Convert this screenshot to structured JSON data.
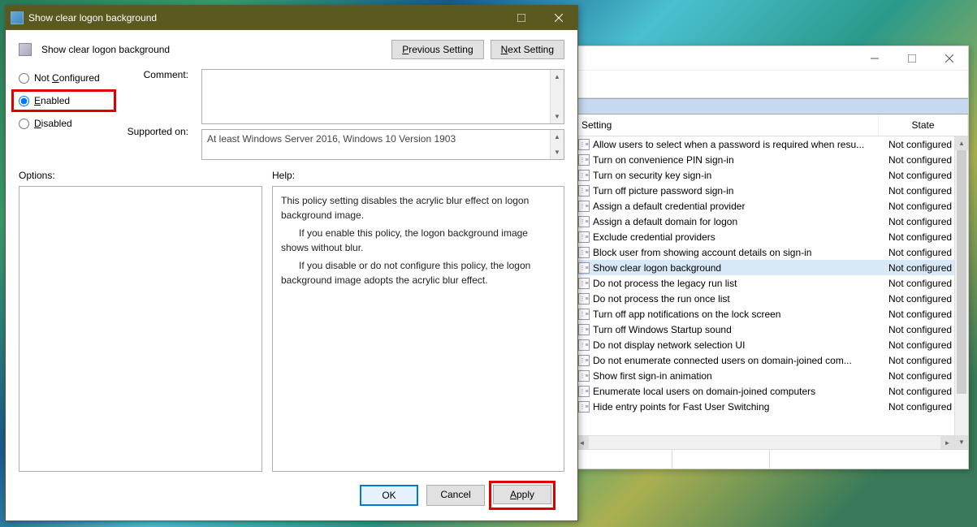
{
  "dialog": {
    "title": "Show clear logon background",
    "subtitle": "Show clear logon background",
    "prev_label": "Previous Setting",
    "next_label": "Next Setting",
    "radio_nc": "Not Configured",
    "radio_en": "Enabled",
    "radio_dis": "Disabled",
    "comment_label": "Comment:",
    "supported_label": "Supported on:",
    "supported_value": "At least Windows Server 2016, Windows 10 Version 1903",
    "options_label": "Options:",
    "help_label": "Help:",
    "help_p1": "This policy setting disables the acrylic blur effect on logon background image.",
    "help_p2": "If you enable this policy, the logon background image shows without blur.",
    "help_p3": "If you disable or do not configure this policy, the logon background image adopts the acrylic blur effect.",
    "ok": "OK",
    "cancel": "Cancel",
    "apply": "Apply"
  },
  "gp": {
    "col_setting": "Setting",
    "col_state": "State",
    "state_nc": "Not configured",
    "rows": [
      {
        "name": "Allow users to select when a password is required when resu...",
        "sel": false
      },
      {
        "name": "Turn on convenience PIN sign-in",
        "sel": false
      },
      {
        "name": "Turn on security key sign-in",
        "sel": false
      },
      {
        "name": "Turn off picture password sign-in",
        "sel": false
      },
      {
        "name": "Assign a default credential provider",
        "sel": false
      },
      {
        "name": "Assign a default domain for logon",
        "sel": false
      },
      {
        "name": "Exclude credential providers",
        "sel": false
      },
      {
        "name": "Block user from showing account details on sign-in",
        "sel": false
      },
      {
        "name": "Show clear logon background",
        "sel": true
      },
      {
        "name": "Do not process the legacy run list",
        "sel": false
      },
      {
        "name": "Do not process the run once list",
        "sel": false
      },
      {
        "name": "Turn off app notifications on the lock screen",
        "sel": false
      },
      {
        "name": "Turn off Windows Startup sound",
        "sel": false
      },
      {
        "name": "Do not display network selection UI",
        "sel": false
      },
      {
        "name": "Do not enumerate connected users on domain-joined com...",
        "sel": false
      },
      {
        "name": "Show first sign-in animation",
        "sel": false
      },
      {
        "name": "Enumerate local users on domain-joined computers",
        "sel": false
      },
      {
        "name": "Hide entry points for Fast User Switching",
        "sel": false
      }
    ]
  }
}
